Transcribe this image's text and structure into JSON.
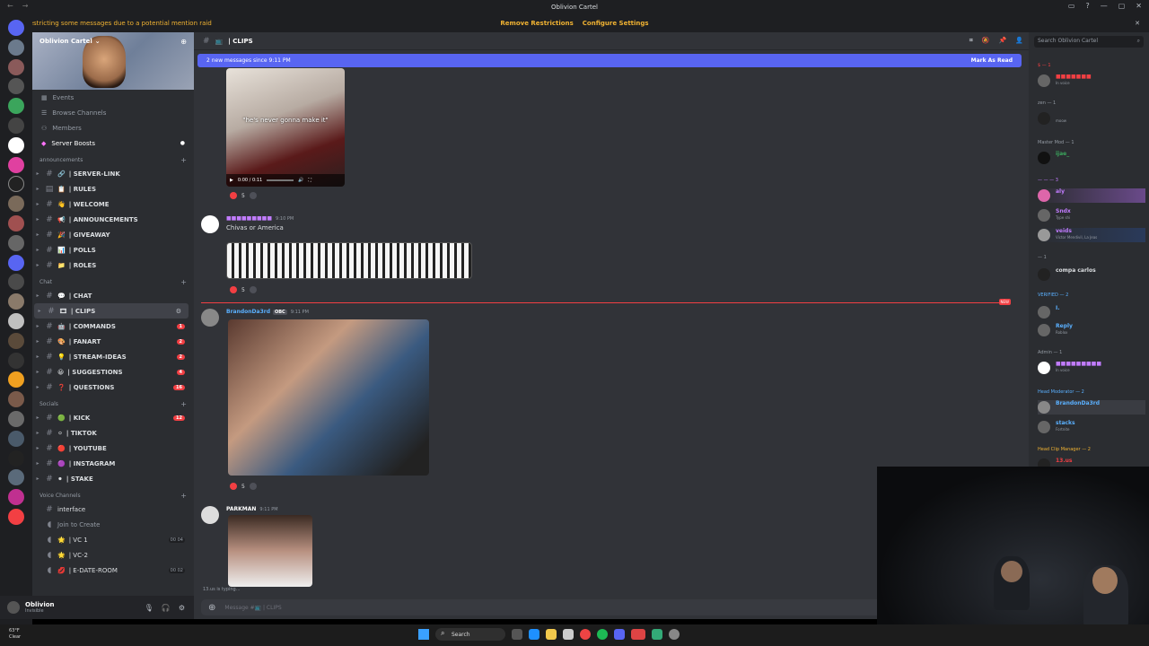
{
  "window": {
    "title": "Oblivion Cartel"
  },
  "notice": {
    "message": "We're restricting some messages due to a potential mention raid",
    "remove": "Remove Restrictions",
    "configure": "Configure Settings"
  },
  "server": {
    "name": "Oblivion Cartel"
  },
  "top_items": [
    "Events",
    "Browse Channels",
    "Members",
    "Server Boosts"
  ],
  "categories": {
    "announcements": "announcements",
    "chat": "Chat",
    "socials": "Socials",
    "voice": "Voice Channels"
  },
  "announce_channels": [
    {
      "label": "| SERVER-LINK",
      "emoji": "🔗",
      "count": ""
    },
    {
      "label": "| RULES",
      "emoji": "📋",
      "count": ""
    },
    {
      "label": "| WELCOME",
      "emoji": "👋",
      "count": ""
    },
    {
      "label": "| ANNOUNCEMENTS",
      "emoji": "📢",
      "count": ""
    },
    {
      "label": "| GIVEAWAY",
      "emoji": "🎉",
      "count": ""
    },
    {
      "label": "| POLLS",
      "emoji": "📊",
      "count": ""
    },
    {
      "label": "| ROLES",
      "emoji": "📁",
      "count": ""
    }
  ],
  "chat_channels": [
    {
      "label": "| CHAT",
      "emoji": "💬",
      "count": ""
    },
    {
      "label": "| CLIPS",
      "emoji": "🎞",
      "count": ""
    },
    {
      "label": "| COMMANDS",
      "emoji": "🤖",
      "count": "1"
    },
    {
      "label": "| FANART",
      "emoji": "🎨",
      "count": "2"
    },
    {
      "label": "| STREAM-IDEAS",
      "emoji": "💡",
      "count": "2"
    },
    {
      "label": "| SUGGESTIONS",
      "emoji": "😀",
      "count": "4"
    },
    {
      "label": "| QUESTIONS",
      "emoji": "❓",
      "count": "16"
    }
  ],
  "social_channels": [
    {
      "label": "| KICK",
      "emoji": "🟢",
      "count": "12"
    },
    {
      "label": "| TIKTOK",
      "emoji": "⚪",
      "count": ""
    },
    {
      "label": "| YOUTUBE",
      "emoji": "🔴",
      "count": ""
    },
    {
      "label": "| INSTAGRAM",
      "emoji": "🟣",
      "count": ""
    },
    {
      "label": "| STAKE",
      "emoji": "⚫",
      "count": ""
    }
  ],
  "voice_channels": [
    {
      "label": "interface",
      "emoji": "",
      "limit": ""
    },
    {
      "label": "Join to Create",
      "emoji": "",
      "limit": ""
    },
    {
      "label": "| VC 1",
      "emoji": "🌟",
      "limit": "00 04"
    },
    {
      "label": "| VC-2",
      "emoji": "🌟",
      "limit": ""
    },
    {
      "label": "| E-DATE-ROOM",
      "emoji": "💋",
      "limit": "00 02"
    }
  ],
  "user": {
    "name": "Oblivion",
    "status": "Invisible"
  },
  "channel": {
    "name": "| CLIPS"
  },
  "new_messages": {
    "text": "2 new messages since 9:11 PM",
    "mark": "Mark As Read"
  },
  "messages": {
    "m1": {
      "caption": "\"he's never gonna make it\"",
      "time": "0:00 / 0:11",
      "reaction": "5"
    },
    "m2": {
      "author": "■■■■■■■■■",
      "ts": "9:10 PM",
      "text": "Chivas or America",
      "reaction": "5"
    },
    "m3": {
      "author": "BrandonDa3rd",
      "tag": "OBC",
      "ts": "9:11 PM",
      "reaction": "5"
    },
    "m4": {
      "author": "PARKMAN",
      "ts": "9:11 PM"
    },
    "new_label": "NEW"
  },
  "typing": "13.us is typing...",
  "input_placeholder": "Message #📺 | CLIPS",
  "members_search": "Search Oblivion Cartel",
  "member_groups": [
    {
      "label": "$ — 1"
    },
    {
      "label": "zen — 1"
    },
    {
      "label": "Master Mod — 1"
    },
    {
      "label": "— — — 3"
    },
    {
      "label": "— 1"
    },
    {
      "label": "VERIFIED — 2"
    },
    {
      "label": "Admin — 1"
    },
    {
      "label": "Head Moderator — 2"
    },
    {
      "label": "Head Clip Manager — 2"
    }
  ],
  "members": [
    {
      "name": "■■■■■■■",
      "sub": "In voice",
      "color": "#f23f43"
    },
    {
      "name": "",
      "sub": "moow",
      "color": "#f23f43"
    },
    {
      "name": "ijae_",
      "sub": "",
      "color": "#3ba55c"
    },
    {
      "name": "aly",
      "sub": "",
      "color": "#c27cff"
    },
    {
      "name": "Sndx",
      "sub": "Type shi",
      "color": "#c27cff"
    },
    {
      "name": "veids",
      "sub": "Victor Mendivil, La Jeas",
      "color": "#c27cff"
    },
    {
      "name": "compa carlos",
      "sub": "",
      "color": "#dbdee1"
    },
    {
      "name": "I.",
      "sub": "",
      "color": "#5ab0ff"
    },
    {
      "name": "Reply",
      "sub": "Roblox",
      "color": "#5ab0ff"
    },
    {
      "name": "■■■■■■■■■",
      "sub": "In voice",
      "color": "#c27cff"
    },
    {
      "name": "BrandonDa3rd",
      "sub": "",
      "color": "#5ab0ff"
    },
    {
      "name": "stacks",
      "sub": "Fortnite",
      "color": "#5ab0ff"
    },
    {
      "name": "13.us",
      "sub": "",
      "color": "#f23f43"
    }
  ],
  "taskbar": {
    "temp": "63°F",
    "weather": "Clear",
    "search": "Search"
  },
  "colors": {
    "accent": "#5865f2",
    "danger": "#f23f43",
    "warning": "#f0b232"
  }
}
